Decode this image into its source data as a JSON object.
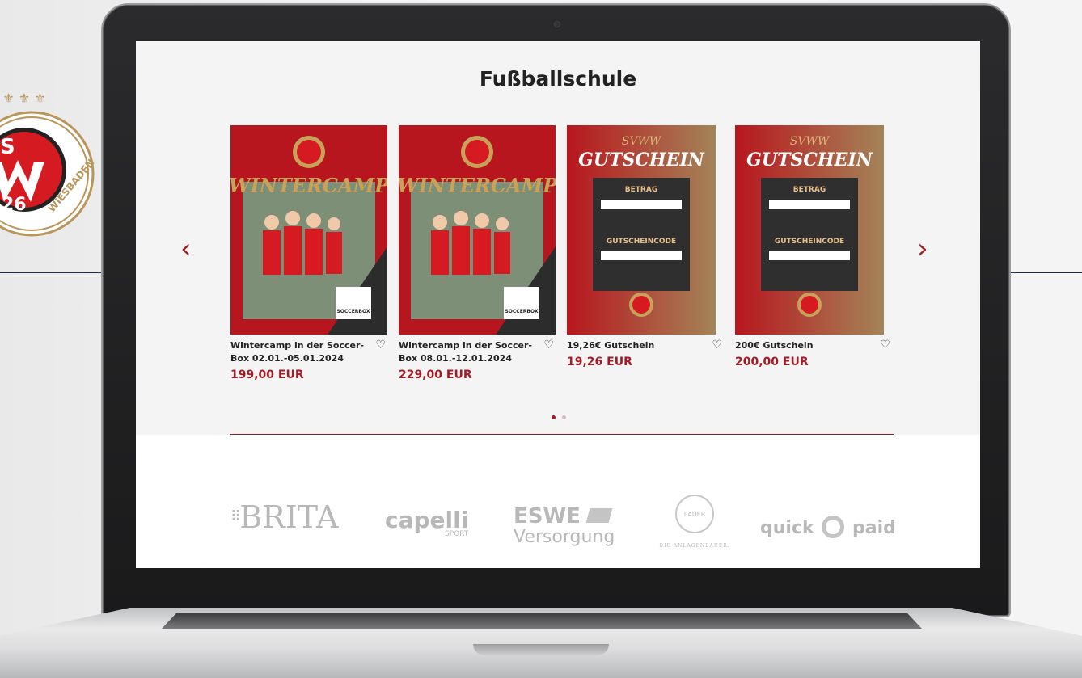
{
  "page": {
    "title": "Fußballschule"
  },
  "badge": {
    "letters_top": "SV",
    "number": "26",
    "ring_text": "WIESBADEN"
  },
  "carousel": {
    "prev_label": "‹",
    "next_label": "›",
    "items": [
      {
        "name": "Wintercamp in der Soccer-Box 02.01.-05.01.2024",
        "price": "199,00 EUR",
        "image_type": "wintercamp",
        "image_title": "WINTERCAMP",
        "logo_text": "SOCCERBOX"
      },
      {
        "name": "Wintercamp in der Soccer-Box 08.01.-12.01.2024",
        "price": "229,00 EUR",
        "image_type": "wintercamp",
        "image_title": "WINTERCAMP",
        "logo_text": "SOCCERBOX"
      },
      {
        "name": "19,26€ Gutschein",
        "price": "19,26 EUR",
        "image_type": "voucher",
        "image_title_top": "SVWW",
        "image_title": "GUTSCHEIN",
        "field1": "BETRAG",
        "field2": "GUTSCHEINCODE"
      },
      {
        "name": "200€ Gutschein",
        "price": "200,00 EUR",
        "image_type": "voucher",
        "image_title_top": "SVWW",
        "image_title": "GUTSCHEIN",
        "field1": "BETRAG",
        "field2": "GUTSCHEINCODE"
      }
    ],
    "dots": 2,
    "active_dot": 0
  },
  "sponsors": [
    "BRITA",
    "capelli",
    "SPORT",
    "ESWE",
    "Versorgung",
    "LAUER",
    "DIE ANLAGENBAUER.",
    "quick",
    "paid"
  ],
  "colors": {
    "accent": "#a31b24",
    "sponsor_gray": "#b8b8b8"
  }
}
